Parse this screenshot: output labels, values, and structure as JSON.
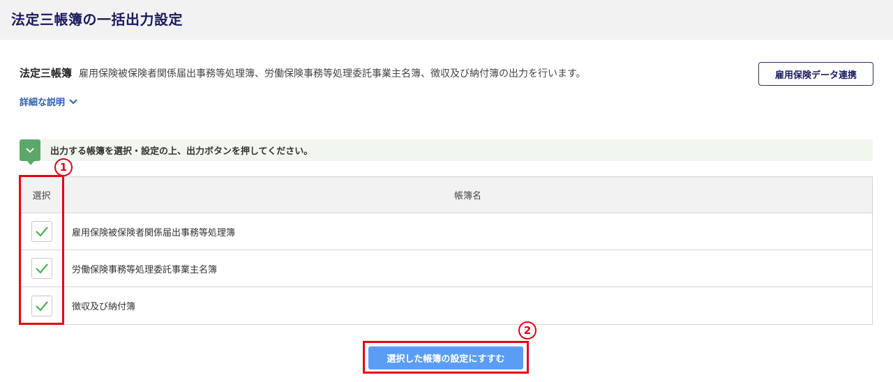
{
  "header": {
    "title": "法定三帳簿の一括出力設定"
  },
  "intro": {
    "title": "法定三帳簿",
    "description": "雇用保険被保険者関係届出事務等処理簿、労働保険事務等処理委託事業主名簿、徴収及び納付簿の出力を行います。"
  },
  "link_button": {
    "label": "雇用保険データ連携"
  },
  "detail_toggle": {
    "label": "詳細な説明",
    "icon": "chevron-down-icon"
  },
  "notice": {
    "text": "出力する帳簿を選択・設定の上、出力ボタンを押してください。",
    "icon": "chevron-down-icon",
    "color": "#5aa86a"
  },
  "table": {
    "headers": {
      "select": "選択",
      "name": "帳簿名"
    },
    "rows": [
      {
        "name": "雇用保険被保険者関係届出事務等処理簿",
        "checked": true
      },
      {
        "name": "労働保険事務等処理委託事業主名簿",
        "checked": true
      },
      {
        "name": "徴収及び納付簿",
        "checked": true
      }
    ]
  },
  "submit_button": {
    "label": "選択した帳簿の設定にすすむ",
    "color": "#5b9df4"
  },
  "annotations": {
    "badge_1": "1",
    "badge_2": "2",
    "color": "#e60012"
  }
}
